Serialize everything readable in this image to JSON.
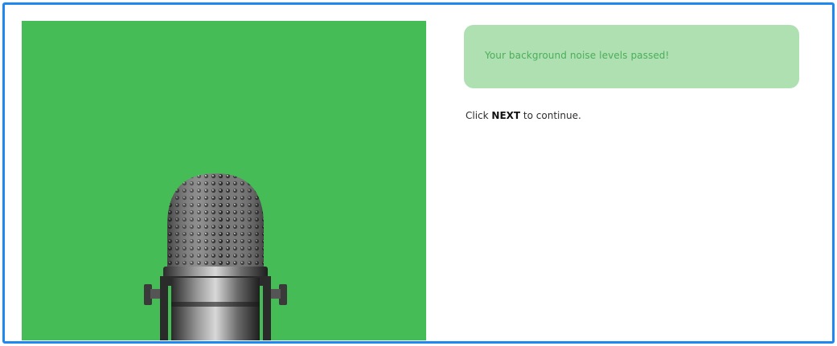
{
  "notice": {
    "message": "Your background noise levels passed!",
    "color": "#aee0b2",
    "text_color": "#4cae58"
  },
  "instruction": {
    "prefix": "Click ",
    "keyword": "NEXT",
    "suffix": " to continue."
  },
  "hero": {
    "background_color": "#45bc55",
    "icon": "microphone-icon"
  },
  "frame": {
    "border_color": "#1f87f0"
  }
}
